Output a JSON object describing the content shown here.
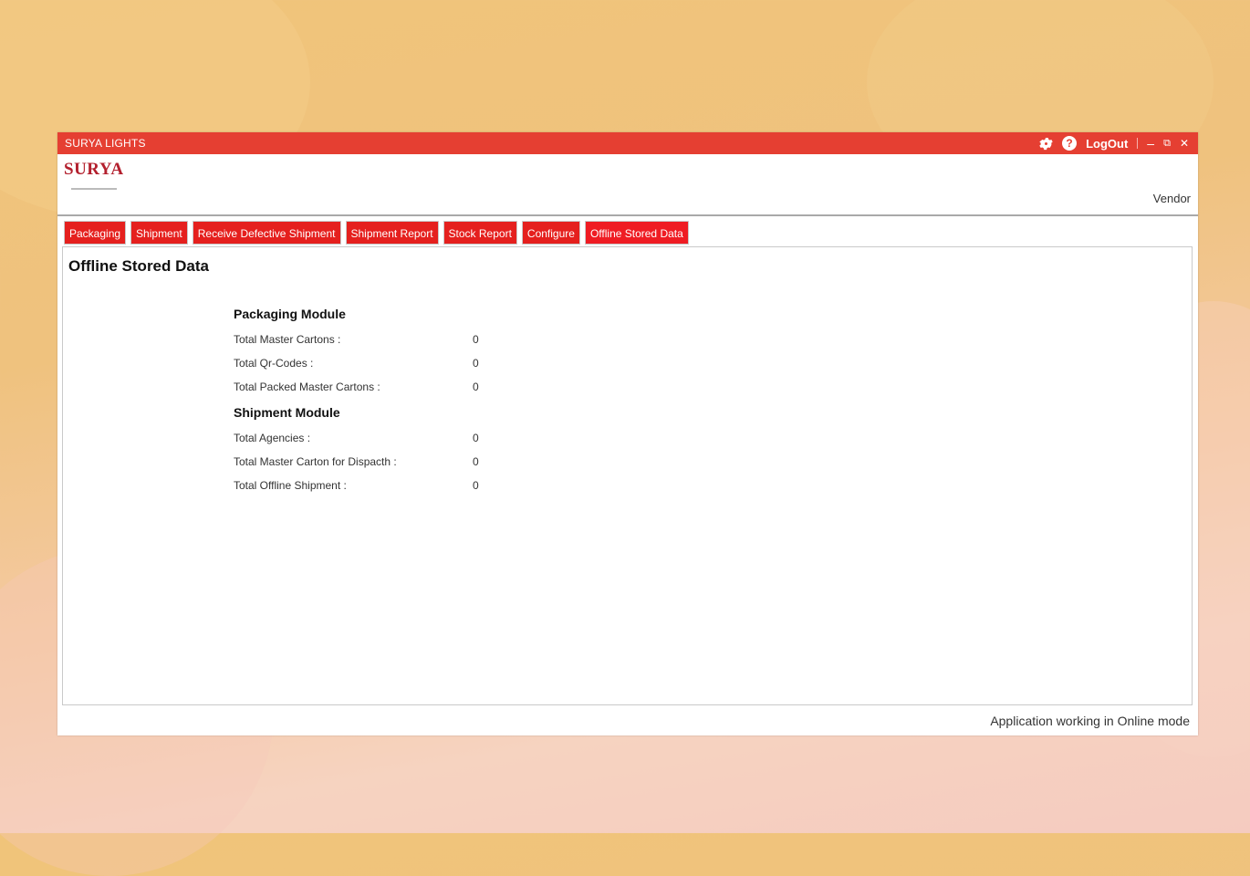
{
  "window": {
    "title": "SURYA LIGHTS",
    "logout_label": "LogOut",
    "settings_icon": "gear-icon",
    "help_icon": "help-icon",
    "minimize_glyph": "–",
    "restore_glyph": "⧉",
    "close_glyph": "✕",
    "accent_color": "#e53f32"
  },
  "header": {
    "logo_text": "SURYA",
    "role": "Vendor"
  },
  "tabs": [
    {
      "label": "Packaging"
    },
    {
      "label": "Shipment"
    },
    {
      "label": "Receive Defective Shipment"
    },
    {
      "label": "Shipment Report"
    },
    {
      "label": "Stock Report"
    },
    {
      "label": "Configure"
    },
    {
      "label": "Offline Stored Data",
      "active": true
    }
  ],
  "page": {
    "title": "Offline Stored Data",
    "packaging": {
      "heading": "Packaging Module",
      "rows": [
        {
          "label": "Total Master Cartons :",
          "value": "0"
        },
        {
          "label": "Total Qr-Codes :",
          "value": "0"
        },
        {
          "label": "Total Packed Master Cartons :",
          "value": "0"
        }
      ]
    },
    "shipment": {
      "heading": "Shipment Module",
      "rows": [
        {
          "label": "Total Agencies :",
          "value": "0"
        },
        {
          "label": "Total Master Carton for Dispacth :",
          "value": "0"
        },
        {
          "label": "Total Offline Shipment :",
          "value": "0"
        }
      ]
    }
  },
  "status_bar": {
    "text": "Application working in Online mode"
  }
}
